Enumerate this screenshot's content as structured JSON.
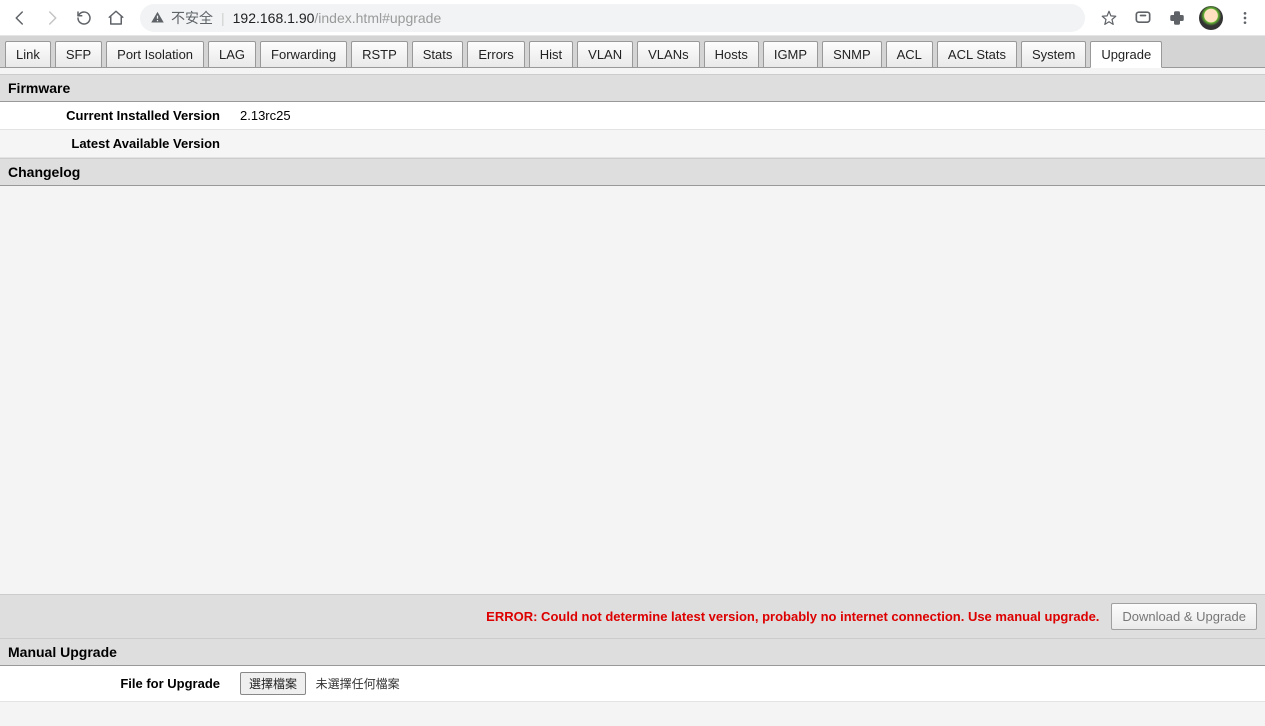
{
  "browser": {
    "security_label": "不安全",
    "url_host": "192.168.1.90",
    "url_path": "/index.html#upgrade"
  },
  "tabs": [
    {
      "label": "Link"
    },
    {
      "label": "SFP"
    },
    {
      "label": "Port Isolation"
    },
    {
      "label": "LAG"
    },
    {
      "label": "Forwarding"
    },
    {
      "label": "RSTP"
    },
    {
      "label": "Stats"
    },
    {
      "label": "Errors"
    },
    {
      "label": "Hist"
    },
    {
      "label": "VLAN"
    },
    {
      "label": "VLANs"
    },
    {
      "label": "Hosts"
    },
    {
      "label": "IGMP"
    },
    {
      "label": "SNMP"
    },
    {
      "label": "ACL"
    },
    {
      "label": "ACL Stats"
    },
    {
      "label": "System"
    },
    {
      "label": "Upgrade"
    }
  ],
  "active_tab": "Upgrade",
  "firmware": {
    "section_title": "Firmware",
    "current_label": "Current Installed Version",
    "current_value": "2.13rc25",
    "latest_label": "Latest Available Version",
    "latest_value": ""
  },
  "changelog": {
    "section_title": "Changelog",
    "body": ""
  },
  "error_row": {
    "error_text": "ERROR: Could not determine latest version, probably no internet connection. Use manual upgrade.",
    "button_label": "Download & Upgrade"
  },
  "manual": {
    "section_title": "Manual Upgrade",
    "file_label": "File for Upgrade",
    "choose_button": "選擇檔案",
    "no_file_text": "未選擇任何檔案"
  }
}
